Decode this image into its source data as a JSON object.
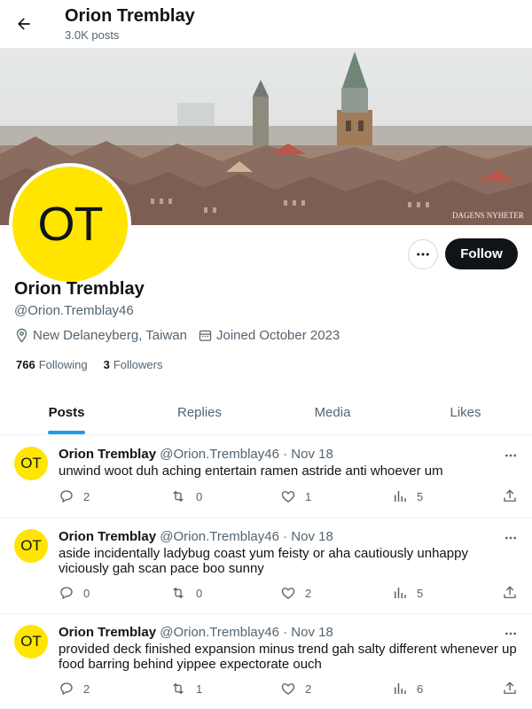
{
  "header": {
    "name": "Orion Tremblay",
    "posts_count": "3.0K posts"
  },
  "profile": {
    "avatar_initials": "OT",
    "name": "Orion Tremblay",
    "handle": "@Orion.Tremblay46",
    "location": "New Delaneyberg, Taiwan",
    "joined": "Joined October 2023",
    "following_count": "766",
    "following_label": "Following",
    "followers_count": "3",
    "followers_label": "Followers",
    "follow_label": "Follow"
  },
  "tabs": [
    {
      "label": "Posts",
      "active": true
    },
    {
      "label": "Replies",
      "active": false
    },
    {
      "label": "Media",
      "active": false
    },
    {
      "label": "Likes",
      "active": false
    }
  ],
  "posts": [
    {
      "avatar_initials": "OT",
      "name": "Orion Tremblay",
      "handle": "@Orion.Tremblay46",
      "date": "Nov 18",
      "text": "unwind woot duh aching entertain ramen astride anti whoever um",
      "replies": "2",
      "reposts": "0",
      "likes": "1",
      "views": "5"
    },
    {
      "avatar_initials": "OT",
      "name": "Orion Tremblay",
      "handle": "@Orion.Tremblay46",
      "date": "Nov 18",
      "text": "aside incidentally ladybug coast yum feisty or aha cautiously unhappy viciously gah scan pace boo sunny",
      "replies": "0",
      "reposts": "0",
      "likes": "2",
      "views": "5"
    },
    {
      "avatar_initials": "OT",
      "name": "Orion Tremblay",
      "handle": "@Orion.Tremblay46",
      "date": "Nov 18",
      "text": "provided deck finished expansion minus trend gah salty different whenever up food barring behind yippee expectorate ouch",
      "replies": "2",
      "reposts": "1",
      "likes": "2",
      "views": "6"
    }
  ],
  "banner_watermark": "DAGENS NYHETER",
  "colors": {
    "accent": "#1d9bf0",
    "avatar_bg": "#ffe500",
    "follow_button": "#0f1419",
    "muted_text": "#536471"
  }
}
